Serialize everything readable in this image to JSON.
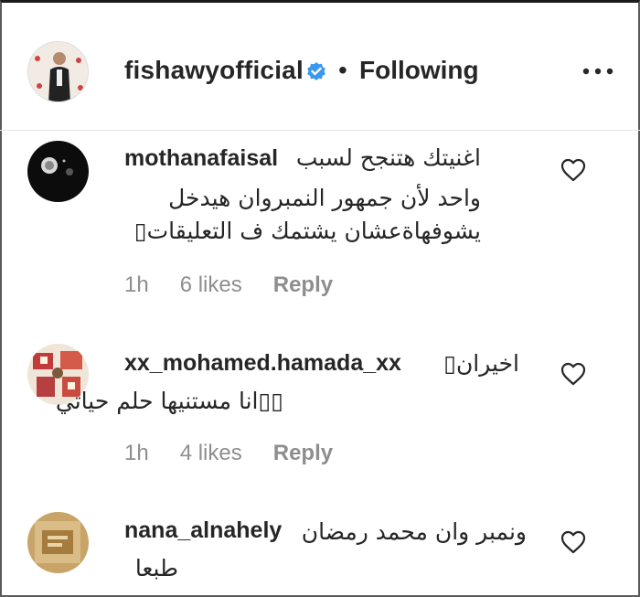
{
  "post": {
    "username": "fishawyofficial",
    "separator": "•",
    "follow_status": "Following"
  },
  "comments": [
    {
      "username": "mothanafaisal",
      "lines": [
        "اغنيتك هتنجح لسبب",
        "واحد لأن جمهور النمبروان هيدخل",
        "يشوفهاةعشان يشتمك ف التعليقات▯"
      ],
      "time": "1h",
      "likes": "6 likes",
      "reply": "Reply"
    },
    {
      "username": "xx_mohamed.hamada_xx",
      "lines": [
        "اخيران▯",
        "▯▯انا مستنيها حلم حياتي"
      ],
      "time": "1h",
      "likes": "4 likes",
      "reply": "Reply"
    },
    {
      "username": "nana_alnahely",
      "lines": [
        "ونمبر وان محمد رمضان",
        "طبعا"
      ]
    }
  ],
  "colors": {
    "text": "#262626",
    "muted": "#8e8e8e",
    "verified": "#3897f0"
  }
}
